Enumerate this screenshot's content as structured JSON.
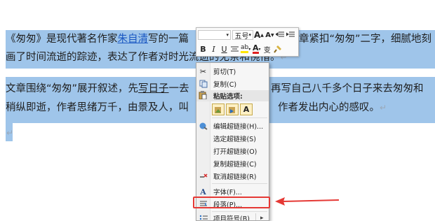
{
  "document": {
    "paragraph1_lines": [
      [
        "《匆匆》是现代著名作家",
        "朱自清",
        "写的一篇",
        "",
        "章紧扣“匆匆”二字，细腻地刻"
      ],
      [
        "画了时间流逝的踪迹，表达了作者对时",
        "光流逝的无奈和惋惜。",
        "↵"
      ]
    ],
    "paragraph2_lines": [
      [
        "文章围绕“匆匆”展开叙述，先",
        "写日子",
        "一去",
        "",
        "再写自己八千多个日子来去匆匆和"
      ],
      [
        "稍纵即逝，作者思绪万千，由景及人，叫",
        "",
        "作者发出内心的感叹。",
        "↵"
      ]
    ],
    "empty_mark": "↵"
  },
  "mini_toolbar": {
    "font_name": "",
    "font_size": "五号",
    "grow_font": "A",
    "shrink_font": "A",
    "bold": "B",
    "italic": "I",
    "underline": "U",
    "font_color": "A",
    "highlight": "ab",
    "phonetic": "变"
  },
  "context_menu": {
    "items": [
      {
        "icon": "cut-icon",
        "label": "剪切(T)"
      },
      {
        "icon": "copy-icon",
        "label": "复制(C)"
      },
      {
        "icon": "paste-icon",
        "label": "粘贴选项:"
      },
      {
        "icon": "edit-hyperlink-icon",
        "label": "编辑超链接(H)..."
      },
      {
        "icon": "",
        "label": "选定超链接(S)"
      },
      {
        "icon": "",
        "label": "打开超链接(O)"
      },
      {
        "icon": "",
        "label": "复制超链接(C)"
      },
      {
        "icon": "remove-hyperlink-icon",
        "label": "取消超链接(R)"
      },
      {
        "icon": "font-icon",
        "label": "字体(F)..."
      },
      {
        "icon": "paragraph-icon",
        "label": "段落(P)..."
      },
      {
        "icon": "bullets-icon",
        "label": "项目符号(B)"
      }
    ],
    "paste_button_text": "A",
    "submenu_arrow": "▸"
  },
  "colors": {
    "selection": "#9fc5ea",
    "annotation_red": "#e53935",
    "link_blue": "#1a57c2"
  }
}
